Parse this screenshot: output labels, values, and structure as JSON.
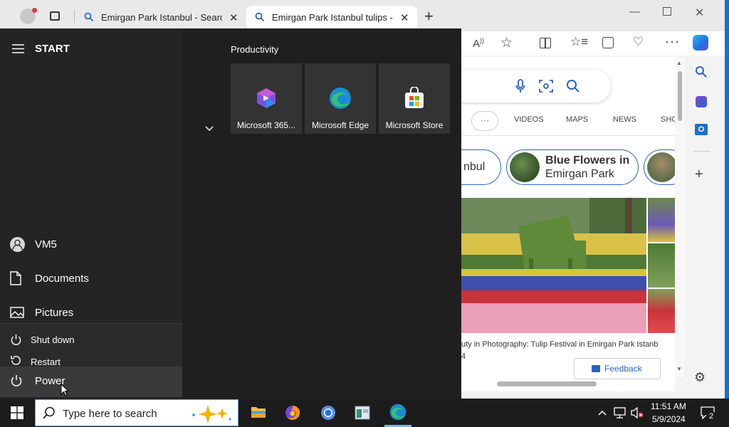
{
  "browser": {
    "tabs": [
      {
        "title": "Emirgan Park Istanbul - Search"
      },
      {
        "title": "Emirgan Park Istanbul tulips - Se"
      }
    ],
    "search_tabs": {
      "more": "···",
      "items": [
        "VIDEOS",
        "MAPS",
        "NEWS",
        "SHO"
      ]
    },
    "related": [
      {
        "label": "nbul"
      },
      {
        "label_line1": "Blue Flowers in",
        "label_line2": "Emirgan Park"
      }
    ],
    "image_caption_line1": "uty in Photography: Tulip Festival in Emirgan Park Istanb",
    "image_caption_line2": "4",
    "feedback_label": "Feedback"
  },
  "start_menu": {
    "title": "START",
    "group_title": "Productivity",
    "tiles": [
      {
        "label": "Microsoft 365..."
      },
      {
        "label": "Microsoft Edge"
      },
      {
        "label": "Microsoft Store"
      }
    ],
    "user": "VM5",
    "items": [
      "Documents",
      "Pictures"
    ],
    "power_flyout": {
      "shutdown": "Shut down",
      "restart": "Restart"
    },
    "power_label": "Power"
  },
  "taskbar": {
    "search_placeholder": "Type here to search",
    "time": "11:51 AM",
    "date": "5/9/2024",
    "notification_count": "2"
  },
  "colors": {
    "accent": "#0078d4",
    "start_bg": "#1f1f1f",
    "taskbar_bg": "#1c1c1c"
  }
}
